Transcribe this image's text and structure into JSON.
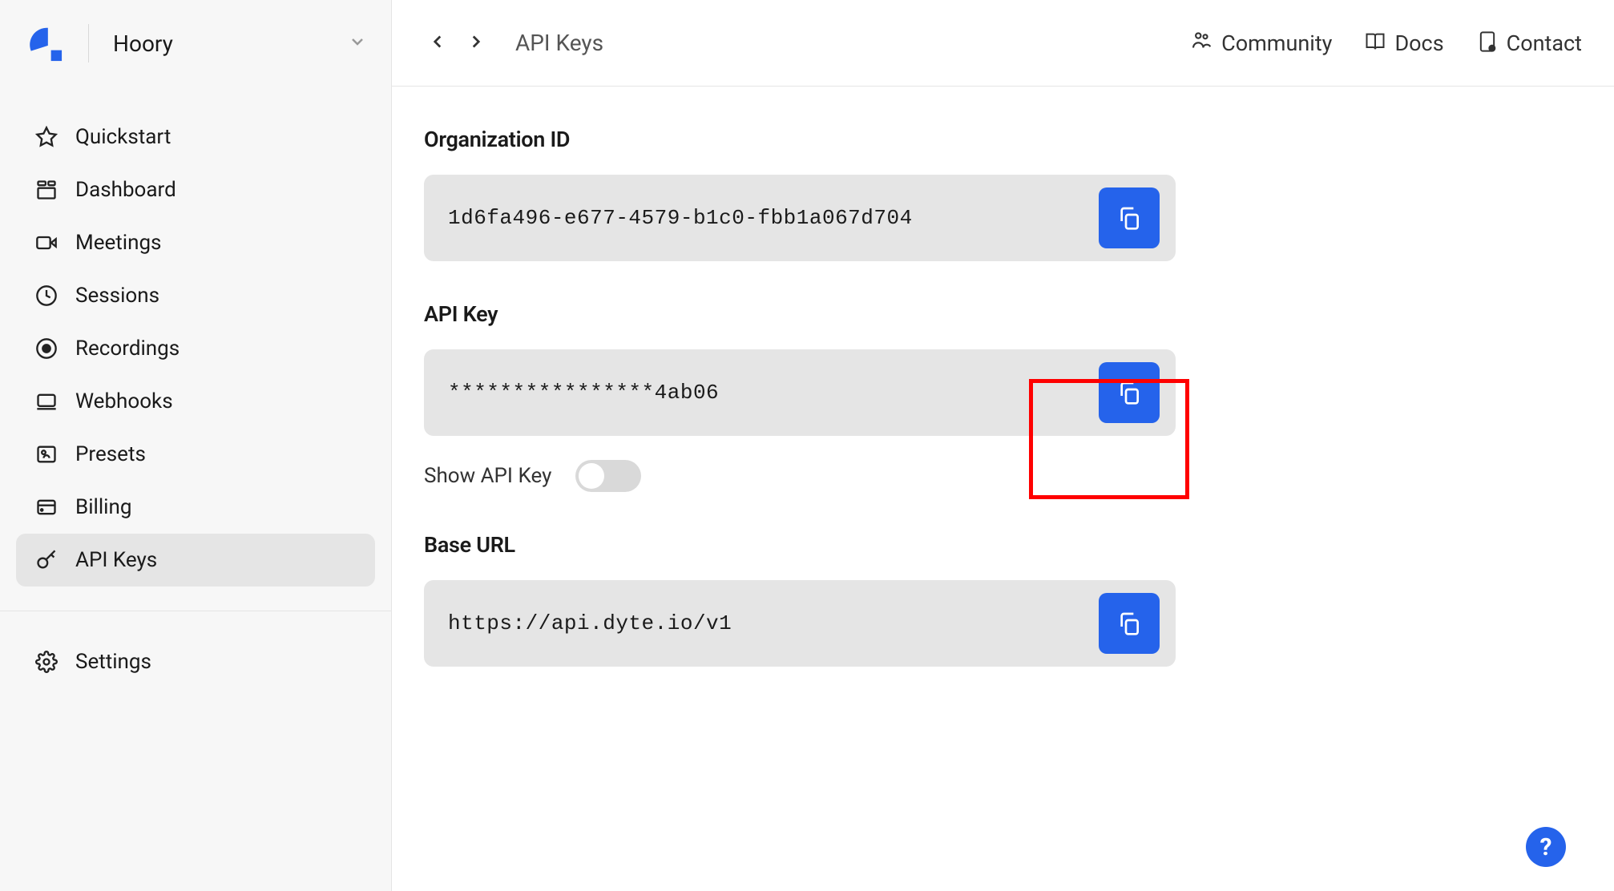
{
  "sidebar": {
    "org_name": "Hoory",
    "nav": [
      {
        "icon": "star",
        "label": "Quickstart"
      },
      {
        "icon": "dashboard",
        "label": "Dashboard"
      },
      {
        "icon": "video",
        "label": "Meetings"
      },
      {
        "icon": "clock",
        "label": "Sessions"
      },
      {
        "icon": "record",
        "label": "Recordings"
      },
      {
        "icon": "laptop",
        "label": "Webhooks"
      },
      {
        "icon": "presets",
        "label": "Presets"
      },
      {
        "icon": "billing",
        "label": "Billing"
      },
      {
        "icon": "key",
        "label": "API Keys"
      }
    ],
    "settings_label": "Settings"
  },
  "topbar": {
    "title": "API Keys",
    "links": {
      "community": "Community",
      "docs": "Docs",
      "contact": "Contact"
    }
  },
  "fields": {
    "org_id_label": "Organization ID",
    "org_id_value": "1d6fa496-e677-4579-b1c0-fbb1a067d704",
    "api_key_label": "API Key",
    "api_key_value": "****************4ab06",
    "show_api_key_label": "Show API Key",
    "base_url_label": "Base URL",
    "base_url_value": "https://api.dyte.io/v1"
  }
}
